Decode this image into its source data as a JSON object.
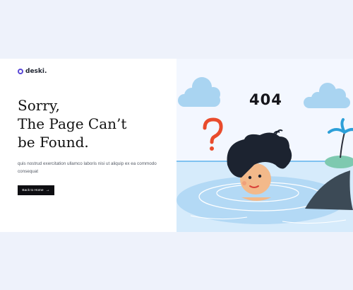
{
  "brand": {
    "name": "deski."
  },
  "hero": {
    "headline": [
      "Sorry,",
      "The Page Can’t",
      "be Found."
    ],
    "description": "quis nostrud exercitation ullamco laboris nisi ut aliquip ex ea commodo consequat",
    "cta_label": "Back to Home",
    "cta_icon": "→"
  },
  "illustration": {
    "error_code": "404",
    "icons": [
      "cloud-icon",
      "question-mark-icon",
      "palm-tree-icon",
      "shark-fin-icon",
      "drowning-boy-icon"
    ]
  },
  "colors": {
    "page_bg": "#eef2fb",
    "accent": "#5b49d6",
    "button_bg": "#0e0e12",
    "water": "#b3d9f5",
    "cloud": "#a9d4f1",
    "question": "#e94b2c",
    "shark": "#3c4a56"
  }
}
